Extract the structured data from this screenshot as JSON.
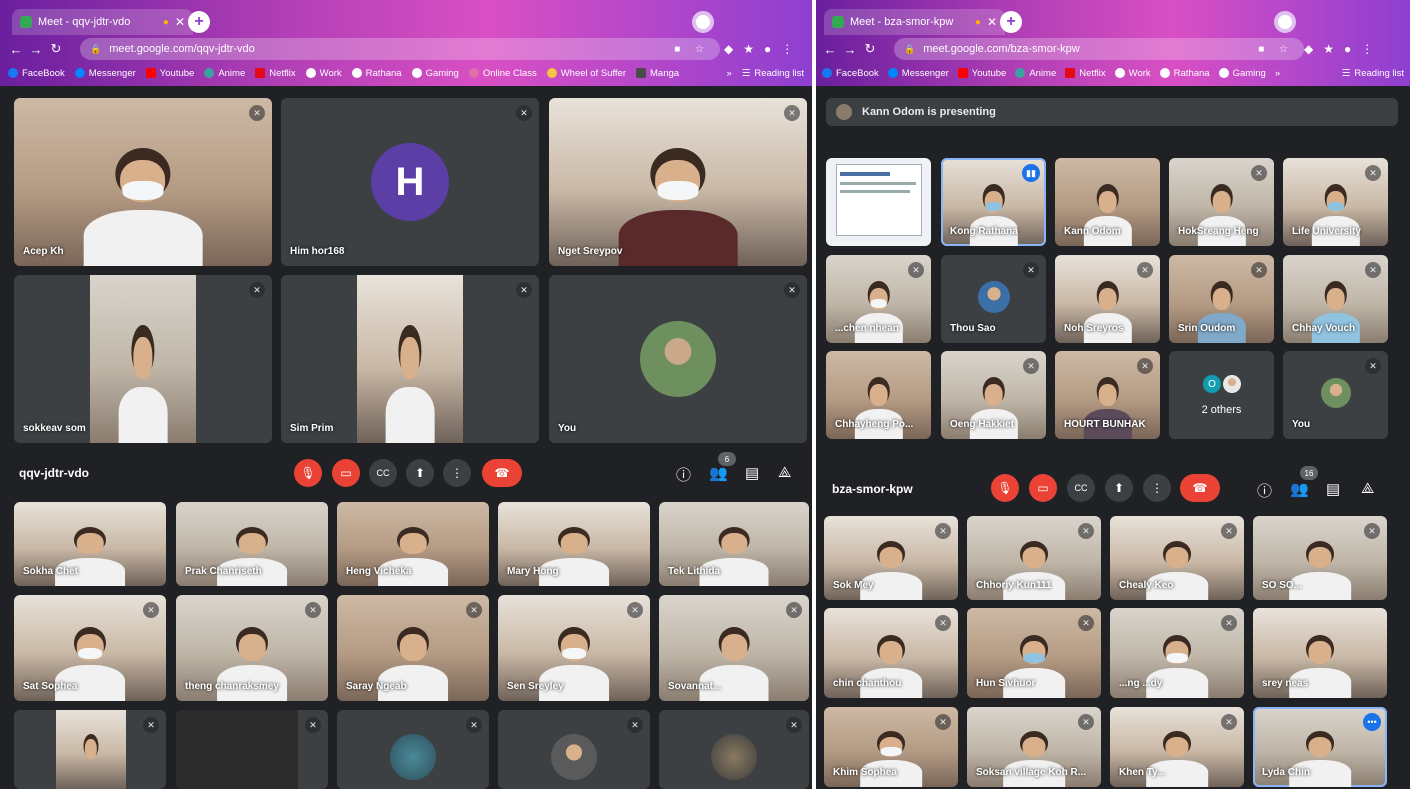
{
  "left": {
    "tab_title": "Meet - qqv-jdtr-vdo",
    "url": "meet.google.com/qqv-jdtr-vdo",
    "bookmarks": [
      "FaceBook",
      "Messenger",
      "Youtube",
      "Anime",
      "Netflix",
      "Work",
      "Rathana",
      "Gaming",
      "Online Class",
      "Wheel of Suffer",
      "Manga"
    ],
    "bookmarks_more": "»",
    "reading_list": "Reading list",
    "meeting_code": "qqv-jdtr-vdo",
    "participant_count": "6",
    "main_tiles": [
      "Acep Kh",
      "Him hor168",
      "Nget Sreypov",
      "sokkeav som",
      "Sim Prim",
      "You"
    ],
    "avatar_letter": "H",
    "tiles_row1": [
      "Sokha Chet",
      "Prak Chanriseth",
      "Heng Vicheka",
      "Mary Hong",
      "Tek Lithida"
    ],
    "tiles_row2": [
      "Sat Sophea",
      "theng chanraksmey",
      "Saray Ngeab",
      "Sen Sreyley",
      "Sovannat..."
    ],
    "tiles_row3": [
      "",
      "",
      "",
      "",
      ""
    ]
  },
  "right": {
    "tab_title": "Meet - bza-smor-kpw",
    "url": "meet.google.com/bza-smor-kpw",
    "bookmarks": [
      "FaceBook",
      "Messenger",
      "Youtube",
      "Anime",
      "Netflix",
      "Work",
      "Rathana",
      "Gaming"
    ],
    "bookmarks_more": "»",
    "reading_list": "Reading list",
    "presenting_text": "Kann Odom is presenting",
    "meeting_code": "bza-smor-kpw",
    "participant_count": "16",
    "grid_row1": [
      "Presentation",
      "Kong Rathana",
      "Kann Odom",
      "HokSreang Heng",
      "Life University"
    ],
    "grid_row2": [
      "...chen nhean",
      "Thou Sao",
      "Noh Sreyros",
      "Srin Oudom",
      "Chhay Vouch"
    ],
    "grid_row3": [
      "Chhayheng Po...",
      "Oeng Hakkiet",
      "HOURT BUNHAK",
      "2 others",
      "You"
    ],
    "others_letter": "O",
    "tiles_row1": [
      "Sok Mey",
      "Chhoriy Kun111",
      "Chealy Keo",
      "SO SO..."
    ],
    "tiles_row2": [
      "chin chanthou",
      "Hun Sivhuor",
      "...ng ...dy",
      "srey neas"
    ],
    "tiles_row3": [
      "Khim Sophea",
      "Soksan village Koh R...",
      "Khen Ty...",
      "Lyda Chin"
    ]
  },
  "icons": {
    "mic_off": "mic-off-icon",
    "cam_off": "camera-off-icon",
    "captions": "captions-icon",
    "present": "present-icon",
    "more": "more-vert-icon",
    "end": "end-call-icon",
    "info": "info-icon",
    "people": "people-icon",
    "chat": "chat-icon",
    "activities": "activities-icon"
  }
}
